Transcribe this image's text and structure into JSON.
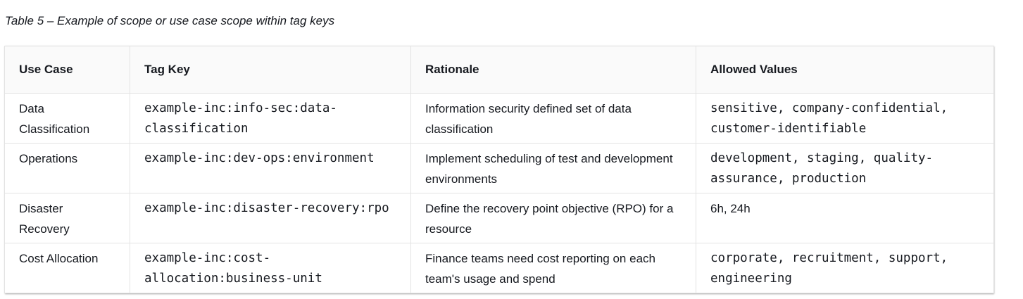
{
  "caption": "Table 5 – Example of scope or use case scope within tag keys",
  "table": {
    "headers": [
      "Use Case",
      "Tag Key",
      "Rationale",
      "Allowed Values"
    ],
    "rows": [
      {
        "use_case": "Data Classification",
        "tag_key": "example-inc:info-sec:data-classification",
        "rationale": "Information security defined set of data classification",
        "allowed_values": "sensitive, company-confidential, customer-identifiable"
      },
      {
        "use_case": "Operations",
        "tag_key": "example-inc:dev-ops:environment",
        "rationale": "Implement scheduling of test and development environments",
        "allowed_values": "development, staging, quality-assurance, production"
      },
      {
        "use_case": "Disaster Recovery",
        "tag_key": "example-inc:disaster-recovery:rpo",
        "rationale": "Define the recovery point objective (RPO) for a resource",
        "allowed_values": "6h, 24h"
      },
      {
        "use_case": "Cost Allocation",
        "tag_key": "example-inc:cost-allocation:business-unit",
        "rationale": "Finance teams need cost reporting on each team's usage and spend",
        "allowed_values": "corporate, recruitment, support, engineering"
      }
    ]
  }
}
